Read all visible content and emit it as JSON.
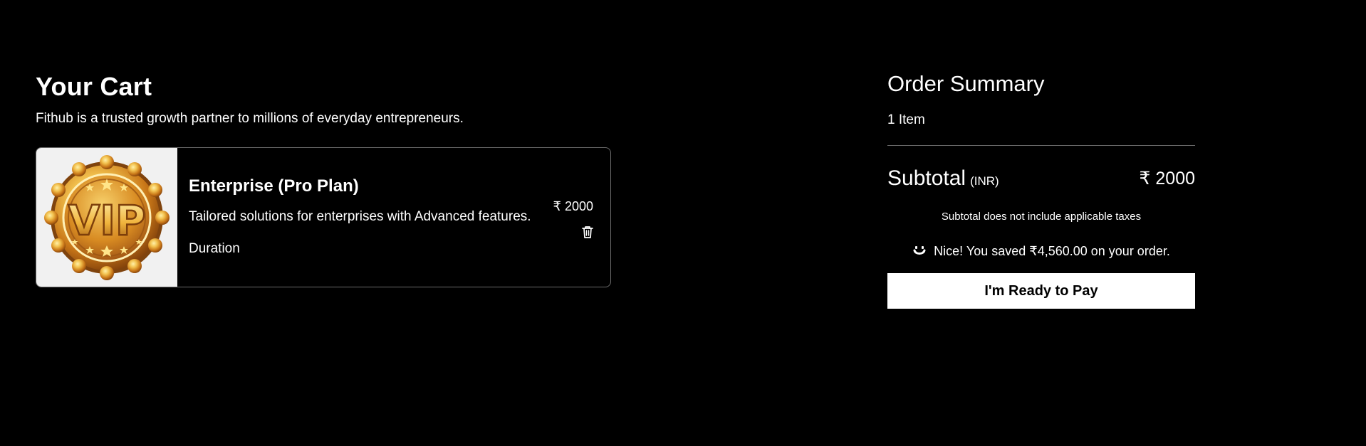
{
  "cart": {
    "title": "Your Cart",
    "subtitle": "Fithub is a trusted growth partner to millions of everyday entrepreneurs.",
    "items": [
      {
        "image_label": "VIP",
        "name": "Enterprise (Pro Plan)",
        "description": "Tailored solutions for enterprises with Advanced features.",
        "duration_label": "Duration",
        "price": "₹ 2000",
        "delete_icon": "trash-icon"
      }
    ]
  },
  "summary": {
    "title": "Order Summary",
    "item_count": "1 Item",
    "subtotal_label": "Subtotal",
    "subtotal_currency": "(INR)",
    "subtotal_amount": "₹ 2000",
    "tax_note": "Subtotal does not include applicable taxes",
    "savings_icon": "smile-icon",
    "savings_text": "Nice! You saved ₹4,560.00 on your order.",
    "pay_button_label": "I'm Ready to Pay"
  },
  "colors": {
    "background": "#000000",
    "text": "#ffffff",
    "border": "#6b6b6b",
    "button_bg": "#ffffff",
    "button_text": "#000000",
    "gold": "#d89a28",
    "image_bg": "#f1f1f1"
  }
}
